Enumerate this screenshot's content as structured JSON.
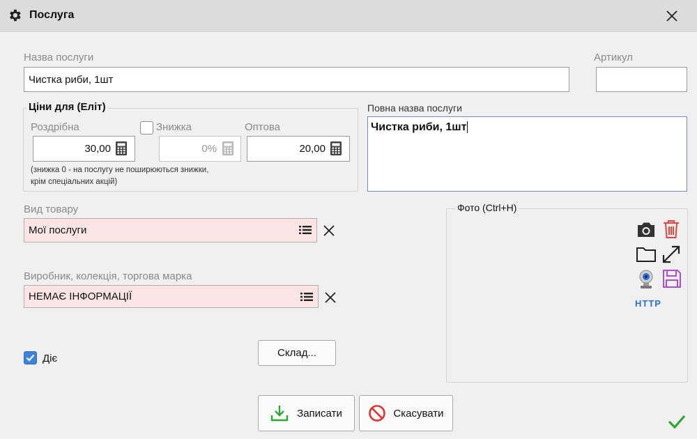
{
  "window": {
    "title": "Послуга"
  },
  "form": {
    "name_label": "Назва послуги",
    "name_value": "Чистка риби, 1шт",
    "article_label": "Артикул",
    "article_value": "",
    "full_name_label": "Повна назва послуги",
    "full_name_value": "Чистка риби, 1шт",
    "prices": {
      "legend": "Ціни   для (Еліт)",
      "retail_label": "Роздрібна",
      "retail_value": "30,00",
      "discount_label": "Знижка",
      "discount_value": "0%",
      "discount_checked": false,
      "wholesale_label": "Оптова",
      "wholesale_value": "20,00",
      "note_line1": "(знижка 0 - на послугу не поширюються знижки,",
      "note_line2": "крім спеціальних акцій)"
    },
    "product_type_label": "Вид товару",
    "product_type_value": "Мої послуги",
    "manufacturer_label": "Виробник, колекція, торгова марка",
    "manufacturer_value": "НЕМАЄ ІНФОРМАЦІЇ",
    "active_label": "Діє",
    "active_checked": true,
    "warehouse_button": "Склад...",
    "photo_legend": "Фото (Ctrl+H)",
    "photo_http_label": "http"
  },
  "buttons": {
    "save": "Записати",
    "cancel": "Скасувати"
  },
  "colors": {
    "pink_field": "#fde5e5",
    "save_green": "#2fa52f",
    "cancel_red": "#e0322f",
    "delete_red": "#e2463e",
    "save_purple": "#b04bd6",
    "http_blue": "#2b6fd1",
    "checkbox_blue": "#3c82d6"
  }
}
